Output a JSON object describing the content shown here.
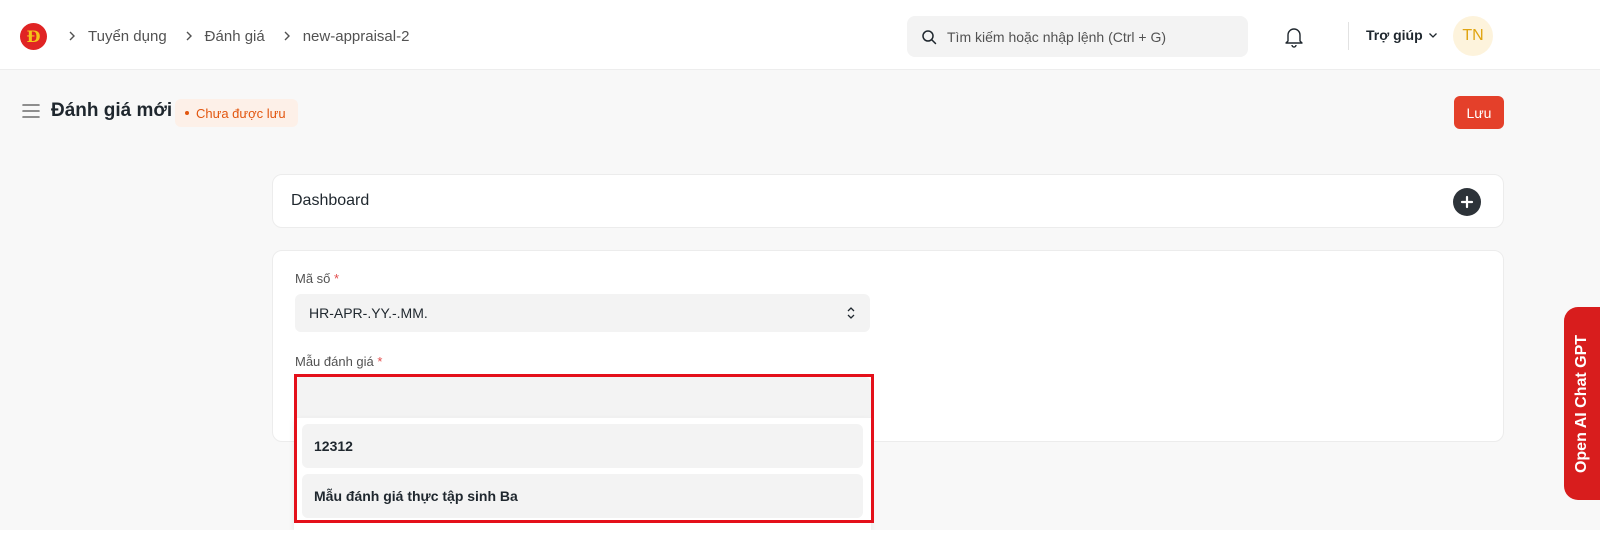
{
  "navbar": {
    "logo_letter": "Đ",
    "breadcrumbs": [
      "Tuyển dụng",
      "Đánh giá",
      "new-appraisal-2"
    ],
    "search_placeholder": "Tìm kiếm hoặc nhập lệnh (Ctrl + G)",
    "help_label": "Trợ giúp",
    "avatar_initials": "TN"
  },
  "page": {
    "title": "Đánh giá mới",
    "status": "Chưa được lưu",
    "save_label": "Lưu"
  },
  "dashboard": {
    "title": "Dashboard"
  },
  "form": {
    "naming_series_label": "Mã số",
    "naming_series_value": "HR-APR-.YY.-.MM.",
    "template_label": "Mẫu đánh giá",
    "template_value": "",
    "required_mark": "*"
  },
  "dropdown": {
    "options": [
      "12312",
      "Mẫu đánh giá thực tập sinh Ba"
    ]
  },
  "side_tab": {
    "label": "Open AI Chat GPT"
  },
  "colors": {
    "primary": "#e4402a",
    "highlight": "#e4101a",
    "status": "#e2560f"
  }
}
